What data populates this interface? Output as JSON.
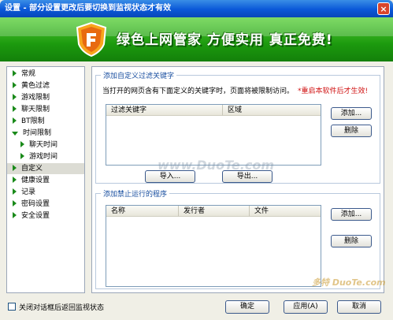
{
  "window": {
    "title": "设置 - 部分设置更改后要切换到监视状态才有效",
    "close_glyph": "×"
  },
  "banner": {
    "slogan": "绿色上网管家  方便实用  真正免费!"
  },
  "nav": {
    "items": [
      {
        "label": "常规"
      },
      {
        "label": "黄色过滤"
      },
      {
        "label": "游戏限制"
      },
      {
        "label": "聊天限制"
      },
      {
        "label": "BT限制"
      },
      {
        "label": "时间限制"
      },
      {
        "label": "聊天时间"
      },
      {
        "label": "游戏时间"
      },
      {
        "label": "自定义"
      },
      {
        "label": "健康设置"
      },
      {
        "label": "记录"
      },
      {
        "label": "密码设置"
      },
      {
        "label": "安全设置"
      }
    ],
    "selected": "自定义"
  },
  "keywords": {
    "group_title": "添加自定义过滤关键字",
    "desc": "当打开的网页含有下面定义的关键字时，页面将被限制访问。",
    "warning": "*重启本软件后才生效!",
    "columns": [
      "过滤关键字",
      "区域"
    ],
    "add": "添加...",
    "delete": "删除",
    "import": "导入...",
    "export": "导出..."
  },
  "programs": {
    "group_title": "添加禁止运行的程序",
    "columns": [
      "名称",
      "发行者",
      "文件"
    ],
    "add": "添加...",
    "delete": "删除"
  },
  "footer": {
    "checkbox_label": "关闭对话框后返回监视状态",
    "ok": "确定",
    "apply": "应用(A)",
    "cancel": "取消"
  },
  "watermark": {
    "center": "www.DuoTe.com",
    "corner": "多特 DuoTe.com"
  },
  "colors": {
    "title_blue": "#0a58d8",
    "banner_green": "#1c9a0e",
    "warning_red": "#d01010",
    "group_title_blue": "#1a4fa0"
  }
}
